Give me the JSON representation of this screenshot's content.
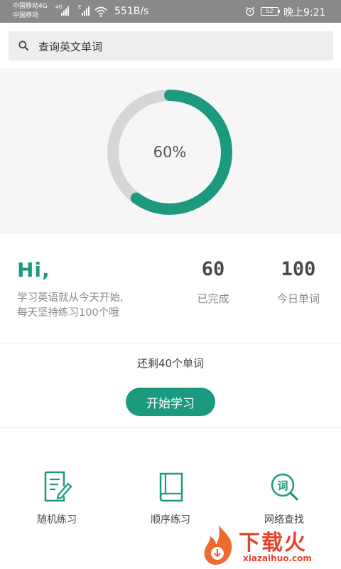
{
  "status_bar": {
    "carrier_1": "中国移动4G",
    "carrier_2": "中国移动",
    "signal_tag_1": "4G",
    "signal_tag_2": "E",
    "network_speed": "551B/s",
    "battery": "52",
    "time": "晚上9:21"
  },
  "search": {
    "placeholder": "查询英文单词",
    "icon": "search-icon"
  },
  "progress": {
    "percent": 60,
    "label": "60%",
    "track_color": "#d6d6d6",
    "fill_color": "#1c9a80"
  },
  "greeting": {
    "title": "Hi,",
    "line_1": "学习英语就从今天开始,",
    "line_2": "每天坚持练习100个哦"
  },
  "stats": [
    {
      "value": "60",
      "label": "已完成"
    },
    {
      "value": "100",
      "label": "今日单词"
    }
  ],
  "remaining": "还剩40个单词",
  "start_button": "开始学习",
  "features": [
    {
      "label": "随机练习",
      "icon": "note-edit-icon"
    },
    {
      "label": "顺序练习",
      "icon": "book-icon"
    },
    {
      "label": "网络查找",
      "icon": "word-search-icon"
    }
  ],
  "watermark": {
    "title": "下载火",
    "url": "xiazaihuo.com"
  },
  "colors": {
    "accent": "#1c9a80",
    "status_bar": "#898989"
  }
}
